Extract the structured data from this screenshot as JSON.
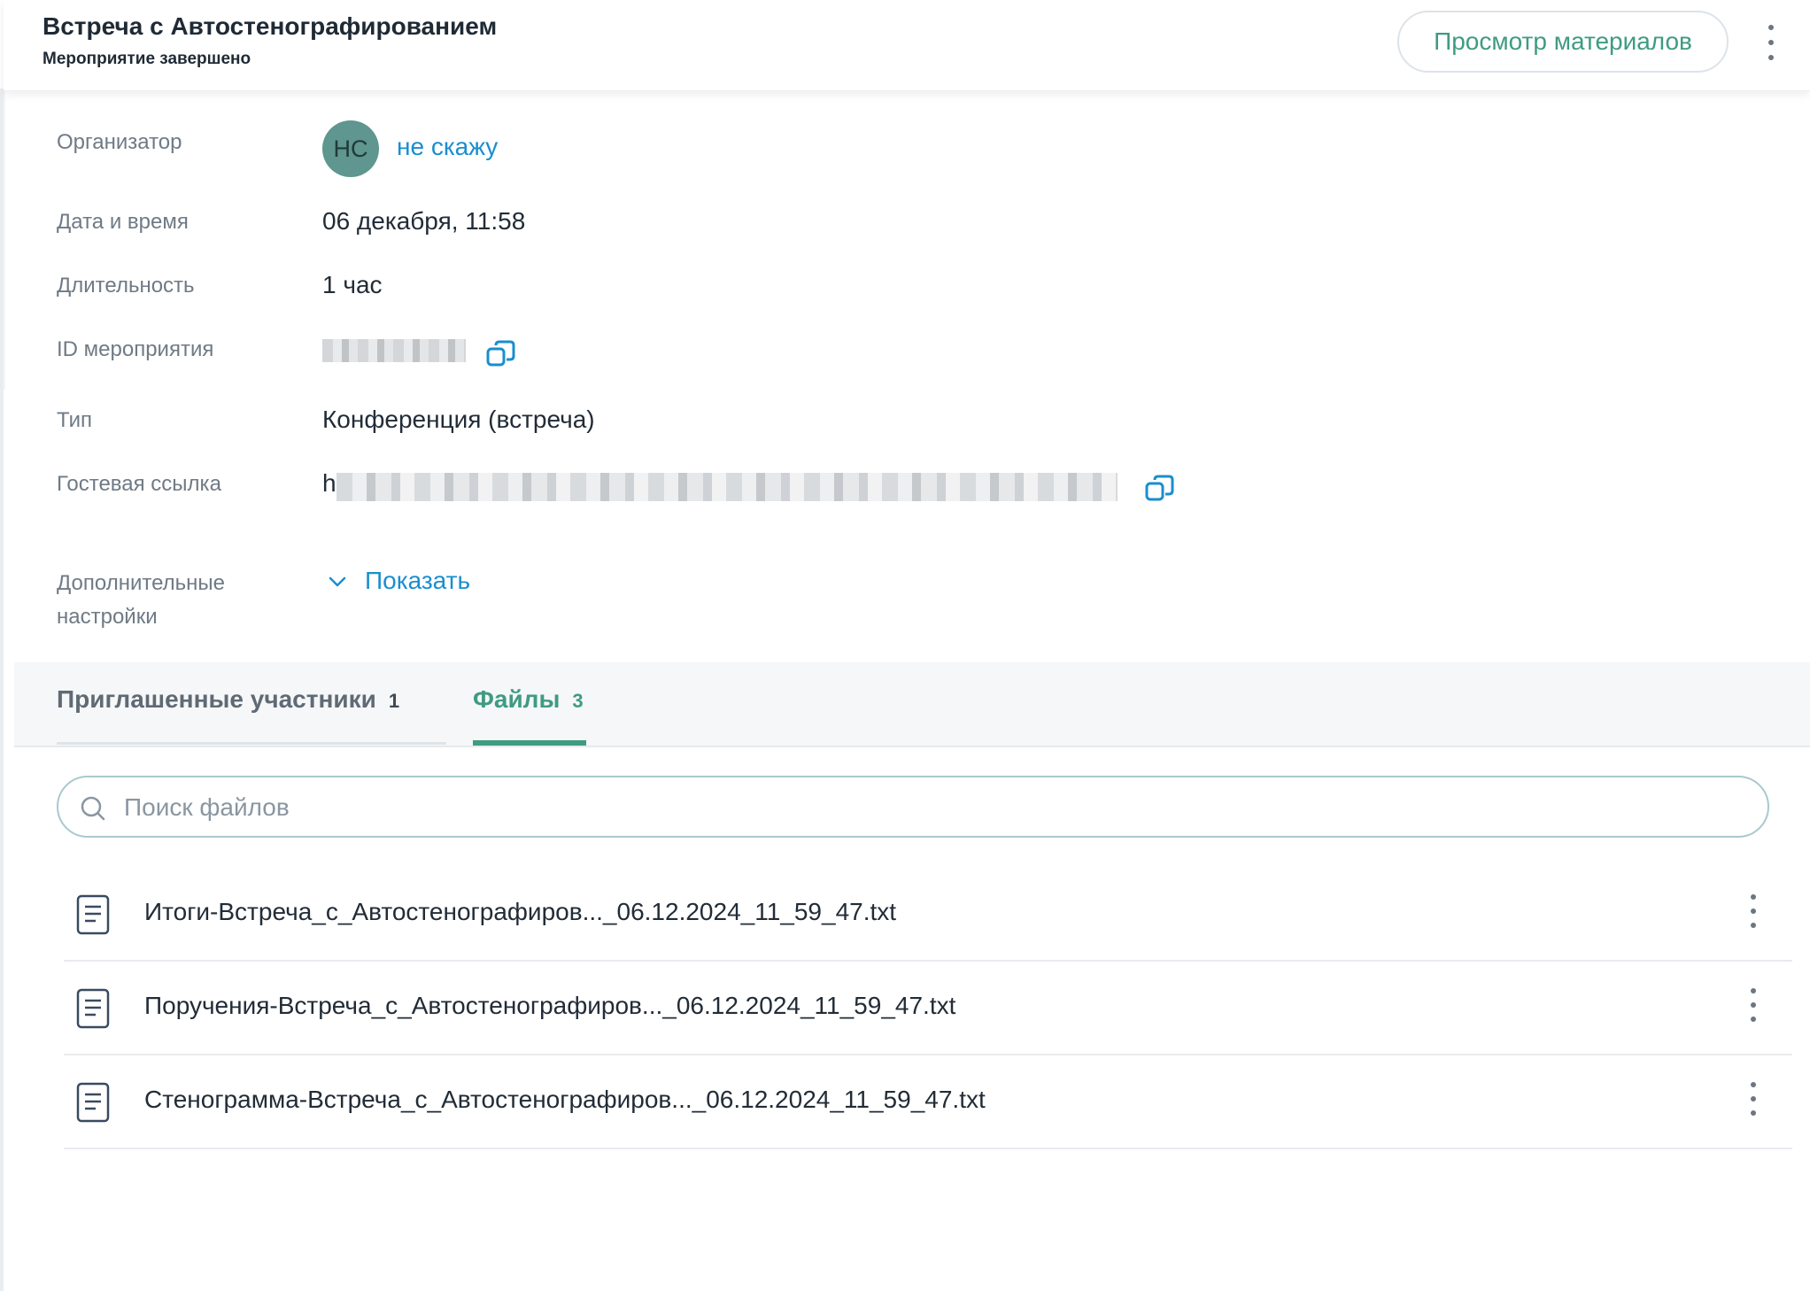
{
  "header": {
    "title": "Встреча с Автостенографированием",
    "status": "Мероприятие завершено",
    "view_button": "Просмотр материалов",
    "menu_icon": "more-vertical-icon"
  },
  "details": {
    "organizer_label": "Организатор",
    "organizer_initials": "НС",
    "organizer_name": "не скажу",
    "datetime_label": "Дата и время",
    "datetime_value": "06 декабря, 11:58",
    "duration_label": "Длительность",
    "duration_value": "1 час",
    "id_label": "ID мероприятия",
    "type_label": "Тип",
    "type_value": "Конференция (встреча)",
    "guest_link_label": "Гостевая ссылка",
    "guest_link_prefix": "h",
    "extra_label_line1": "Дополнительные",
    "extra_label_line2": "настройки",
    "show_link": "Показать"
  },
  "tabs": [
    {
      "label": "Приглашенные участники",
      "count": "1",
      "active": false
    },
    {
      "label": "Файлы",
      "count": "3",
      "active": true
    }
  ],
  "search": {
    "placeholder": "Поиск файлов",
    "value": ""
  },
  "files": [
    {
      "name": "Итоги-Встреча_с_Автостенографиров..._06.12.2024_11_59_47.txt"
    },
    {
      "name": "Поручения-Встреча_с_Автостенографиров..._06.12.2024_11_59_47.txt"
    },
    {
      "name": "Стенограмма-Встреча_с_Автостенографиров..._06.12.2024_11_59_47.txt"
    }
  ],
  "colors": {
    "accent_green": "#3f9b82",
    "link_blue": "#1a8ecf",
    "avatar_bg": "#5f968f"
  }
}
